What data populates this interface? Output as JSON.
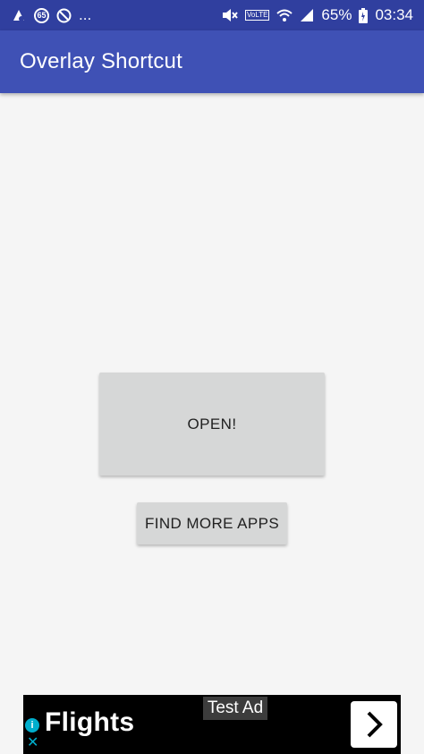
{
  "status_bar": {
    "notification_count": "65",
    "more": "...",
    "volte": "VoLTE",
    "battery_percent": "65%",
    "time": "03:34",
    "icons": [
      "app-notification-icon",
      "badge-65-icon",
      "do-not-disturb-icon",
      "mute-icon",
      "volte-icon",
      "wifi-icon",
      "signal-icon",
      "battery-icon"
    ]
  },
  "app_bar": {
    "title": "Overlay Shortcut",
    "color": "#3f51b5",
    "status_color": "#303f9f"
  },
  "main": {
    "open_label": "OPEN!",
    "find_more_label": "FIND MORE APPS"
  },
  "ad": {
    "label": "Test Ad",
    "headline": "Flights",
    "info_glyph": "i",
    "close_glyph": "✕",
    "icons": [
      "ad-info-icon",
      "ad-close-icon",
      "chevron-right-icon"
    ]
  }
}
